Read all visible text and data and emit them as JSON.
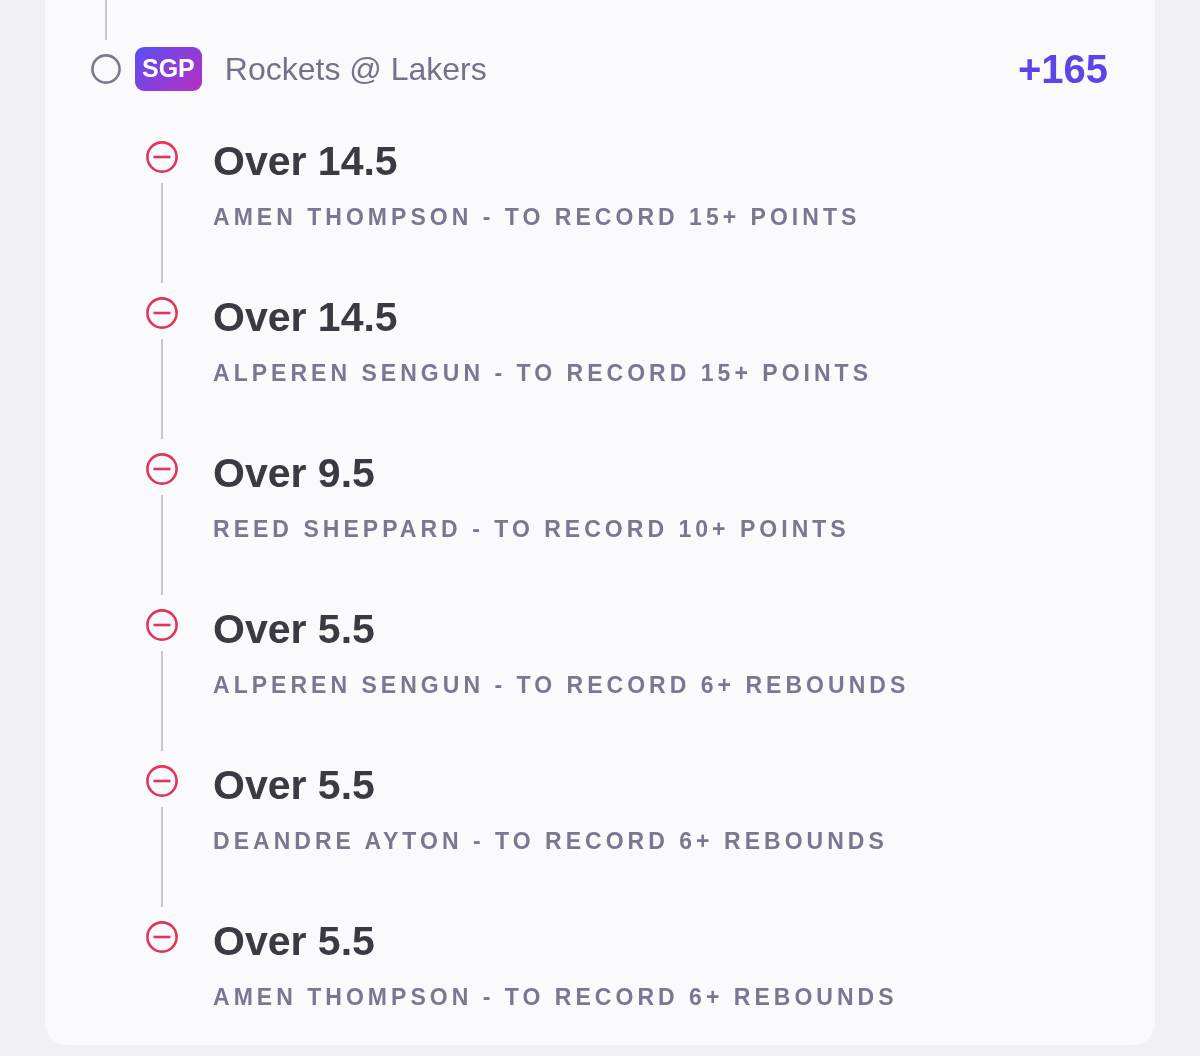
{
  "parlay": {
    "settled": false,
    "badge": "SGP",
    "game": "Rockets @ Lakers",
    "odds": "+165"
  },
  "legs": [
    {
      "lost": true,
      "title": "Over 14.5",
      "description": "AMEN THOMPSON - TO RECORD 15+ POINTS"
    },
    {
      "lost": true,
      "title": "Over 14.5",
      "description": "ALPEREN SENGUN - TO RECORD 15+ POINTS"
    },
    {
      "lost": true,
      "title": "Over 9.5",
      "description": "REED SHEPPARD - TO RECORD 10+ POINTS"
    },
    {
      "lost": true,
      "title": "Over 5.5",
      "description": "ALPEREN SENGUN - TO RECORD 6+ REBOUNDS"
    },
    {
      "lost": true,
      "title": "Over 5.5",
      "description": "DEANDRE AYTON - TO RECORD 6+ REBOUNDS"
    },
    {
      "lost": true,
      "title": "Over 5.5",
      "description": "AMEN THOMPSON - TO RECORD 6+ REBOUNDS"
    }
  ]
}
